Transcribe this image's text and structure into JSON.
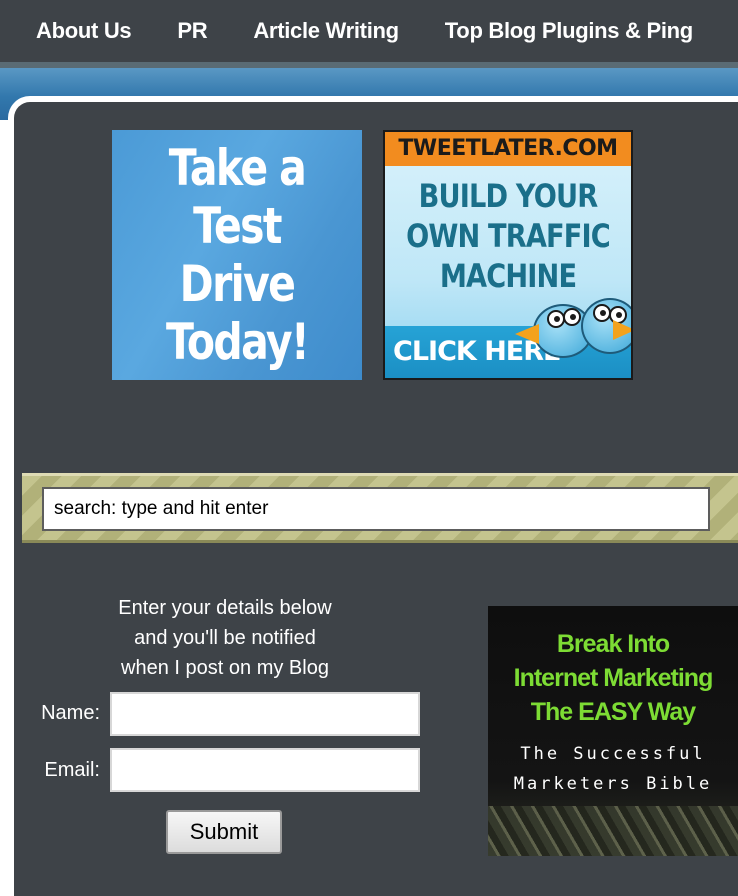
{
  "nav": {
    "items": [
      "About Us",
      "PR",
      "Article Writing",
      "Top Blog Plugins & Ping"
    ]
  },
  "ads": {
    "test_drive": {
      "lines": [
        "Take a",
        "Test Drive",
        "Today!"
      ],
      "color": "#4b9ad6"
    },
    "tweetlater": {
      "banner": "TWEETLATER.COM",
      "headline": [
        "BUILD YOUR",
        "OWN TRAFFIC",
        "MACHINE"
      ],
      "cta": "CLICK HERE",
      "accent": "#f28c1f"
    },
    "book": {
      "headline": [
        "Break Into",
        "Internet Marketing",
        "The EASY Way"
      ],
      "subtitle": [
        "The Successful",
        "Marketers Bible"
      ],
      "accent": "#7ddc34"
    }
  },
  "search": {
    "value": "search: type and hit enter"
  },
  "subscribe": {
    "intro": [
      "Enter your details below",
      "and you'll be notified",
      "when I post on my Blog"
    ],
    "name_label": "Name:",
    "email_label": "Email:",
    "submit_label": "Submit"
  }
}
